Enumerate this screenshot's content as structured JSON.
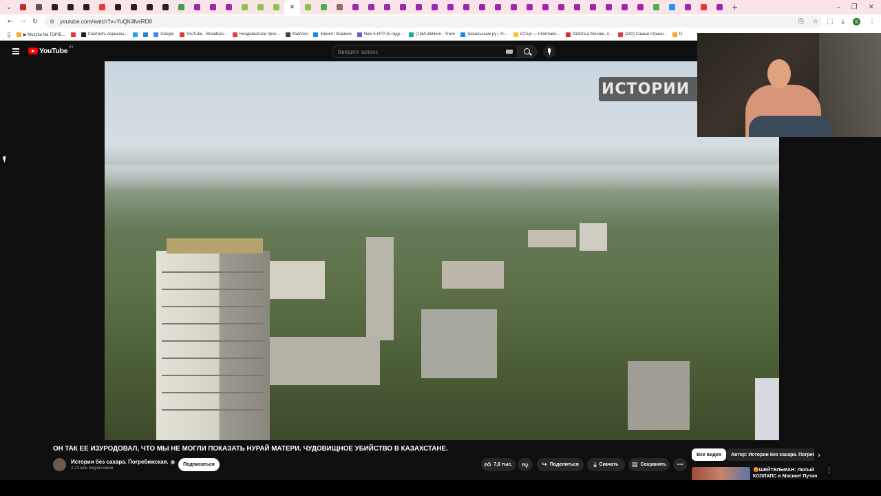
{
  "browser": {
    "url": "youtube.com/watch?v=YuQK4fvsRD8",
    "tab_favicons": [
      "#c62828",
      "#555",
      "#222",
      "#222",
      "#222",
      "#e53935",
      "#222",
      "#222",
      "#222",
      "#222",
      "#43a047",
      "#9c27b0",
      "#9c27b0",
      "#9c27b0",
      "#8bc34a",
      "#8bc34a",
      "#8bc34a",
      "#ffffff",
      "#8bc34a",
      "#4caf50",
      "#8d6e63",
      "#9c27b0",
      "#9c27b0",
      "#9c27b0",
      "#9c27b0",
      "#9c27b0",
      "#9c27b0",
      "#9c27b0",
      "#9c27b0",
      "#9c27b0",
      "#9c27b0",
      "#9c27b0",
      "#9c27b0",
      "#9c27b0",
      "#9c27b0",
      "#9c27b0",
      "#9c27b0",
      "#9c27b0",
      "#9c27b0",
      "#9c27b0",
      "#4caf50",
      "#2196f3",
      "#9c27b0",
      "#e53935",
      "#9c27b0"
    ],
    "active_tab_index": 17,
    "bookmarks": [
      {
        "label": "▶ Muzyka Na TOP!E...",
        "color": "#f9a825"
      },
      {
        "label": "",
        "color": "#e53935"
      },
      {
        "label": "Смотреть сериалы...",
        "color": "#222"
      },
      {
        "label": "",
        "color": "#1da1f2"
      },
      {
        "label": "",
        "color": "#1e88e5"
      },
      {
        "label": "Google",
        "color": "#4285f4"
      },
      {
        "label": "YouTube - Broadcas...",
        "color": "#e53935"
      },
      {
        "label": "Неодекватное прох...",
        "color": "#e53935"
      },
      {
        "label": "Matches",
        "color": "#37474f"
      },
      {
        "label": "Кирилл Зориниз",
        "color": "#1e88e5"
      },
      {
        "label": "Now 5-HTP (5-гидр...",
        "color": "#7e57c2"
      },
      {
        "label": "(1)WLinkHero - Trovo",
        "color": "#26a69a"
      },
      {
        "label": "Шашлычник ру | Уc...",
        "color": "#1e88e5"
      },
      {
        "label": "iCCup — Informatio...",
        "color": "#fbc02d"
      },
      {
        "label": "Работа в Москве, п...",
        "color": "#d32f2f"
      },
      {
        "label": "(342) Самые странн...",
        "color": "#e53935"
      },
      {
        "label": "D",
        "color": "#f9a825"
      }
    ]
  },
  "youtube": {
    "logo_text": "YouTube",
    "region": "BY",
    "search_placeholder": "Введите запрос",
    "watermark": "ИСТОРИИ БЕЗ",
    "video_title": "ОН ТАК ЕЕ ИЗУРОДОВАЛ, ЧТО МЫ НЕ МОГЛИ ПОКАЗАТЬ НУРАЙ МАТЕРИ. ЧУДОВИЩНОЕ УБИЙСТВО В КАЗАХСТАНЕ.",
    "channel_name": "Истории без сахара. Погребижская.",
    "channel_subs": "2,72 млн подписчиков",
    "subscribe_label": "Подписаться",
    "like_count": "7,6 тыс.",
    "share_label": "Поделиться",
    "download_label": "Скачать",
    "save_label": "Сохранить",
    "chips": [
      "Все видео",
      "Автор: Истории без сахара. Погребижская"
    ],
    "recommendation_title": "😡ШЕЙТЕЛЬМАН: Лютый КОЛЛАПС в Москве! Путин ..."
  },
  "colors": {
    "accent": "#ff0000",
    "background": "#0f0f0f",
    "chrome_tabs": "#fbe4e8"
  }
}
